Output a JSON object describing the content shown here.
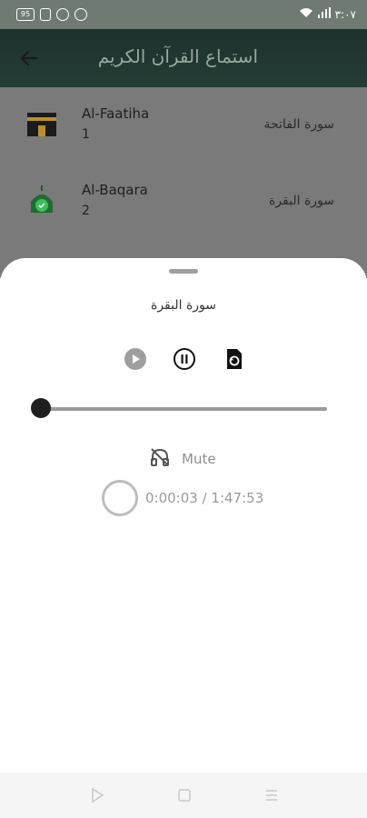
{
  "status_bar": {
    "time": "٣:٠٧",
    "sim_label": "95"
  },
  "app_bar": {
    "title": "استماع القرآن الكريم"
  },
  "surah_list": [
    {
      "english_name": "Al-Faatiha",
      "number": "1",
      "arabic_name": "سورة الفاتحة",
      "icon": "kaaba-icon"
    },
    {
      "english_name": "Al-Baqara",
      "number": "2",
      "arabic_name": "سورة البقرة",
      "icon": "mosque-icon"
    }
  ],
  "player": {
    "title": "سورة البقرة",
    "mute_label": "Mute",
    "time_text": "0:00:03 / 1:47:53",
    "position_fraction": 0.0005
  },
  "colors": {
    "app_bar": "#3b7060",
    "accent_green": "#2e8b3e",
    "dim_overlay": "#7a7a7a"
  }
}
